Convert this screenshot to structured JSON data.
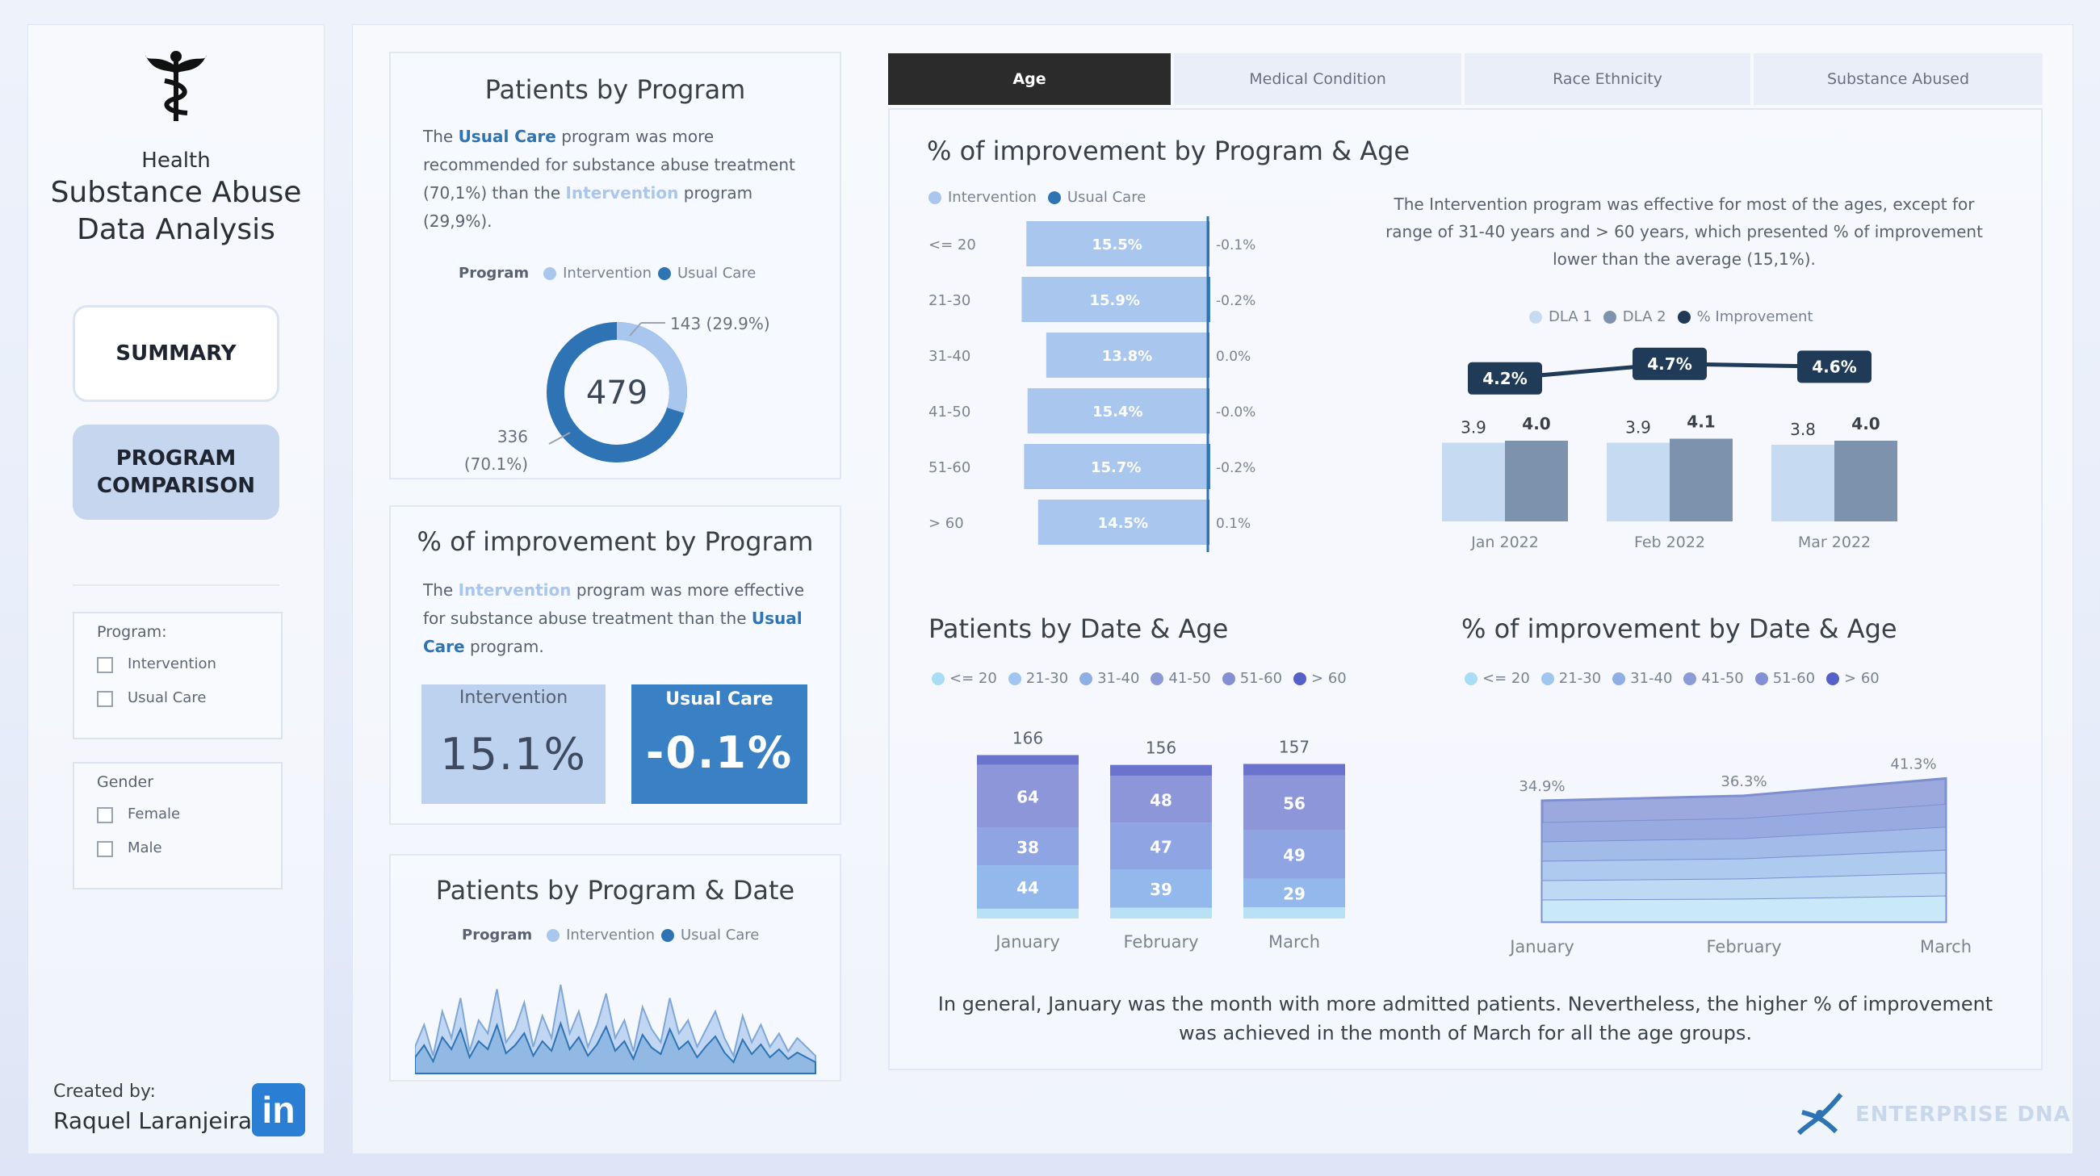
{
  "sidebar": {
    "brand_top": "Health",
    "brand_line1": "Substance Abuse",
    "brand_line2": "Data Analysis",
    "nav": [
      {
        "label": "SUMMARY"
      },
      {
        "label_line1": "PROGRAM",
        "label_line2": "COMPARISON"
      }
    ],
    "filters": [
      {
        "title": "Program:",
        "options": [
          "Intervention",
          "Usual Care"
        ]
      },
      {
        "title": "Gender",
        "options": [
          "Female",
          "Male"
        ]
      }
    ],
    "created_by_label": "Created by:",
    "author": "Raquel Laranjeira",
    "linkedin_glyph": "in"
  },
  "colors": {
    "intervention": "#a9c7ee",
    "usual_care": "#2e74b5",
    "active_tab": "#2b2b2b"
  },
  "patients_by_program": {
    "title": "Patients by Program",
    "desc": {
      "p1": "The ",
      "usual_care": "Usual Care",
      "p2": " program was more recommended for substance abuse treatment (70,1%) than the ",
      "intervention": "Intervention",
      "p3": " program (29,9%)."
    },
    "legend_title": "Program",
    "legend_intervention": "Intervention",
    "legend_usual": "Usual Care",
    "total": "479",
    "label_intervention": "143 (29.9%)",
    "label_usual_value": "336",
    "label_usual_pct": "(70.1%)"
  },
  "improvement_by_program": {
    "title": "% of improvement by Program",
    "desc": {
      "p1": "The ",
      "intervention": "Intervention",
      "p2": " program was more effective for substance abuse treatment than the ",
      "usual_care": "Usual Care",
      "p3": " program."
    },
    "kpi_intervention_label": "Intervention",
    "kpi_intervention_value": "15.1%",
    "kpi_usual_label": "Usual Care",
    "kpi_usual_value": "-0.1%"
  },
  "patients_by_program_date": {
    "title": "Patients by Program & Date",
    "legend_title": "Program",
    "legend_intervention": "Intervention",
    "legend_usual": "Usual Care"
  },
  "tabs": [
    {
      "label": "Age",
      "active": true
    },
    {
      "label": "Medical Condition",
      "active": false
    },
    {
      "label": "Race Ethnicity",
      "active": false
    },
    {
      "label": "Substance Abused",
      "active": false
    }
  ],
  "improvement_by_program_age": {
    "title": "% of improvement by Program & Age",
    "legend_intervention": "Intervention",
    "legend_usual": "Usual Care"
  },
  "dla_note": "The Intervention program was effective for most of the ages, except for range of 31-40 years and > 60 years, which presented % of improvement lower than the average (15,1%).",
  "dla_chart_legend": [
    "DLA 1",
    "DLA 2",
    "% Improvement"
  ],
  "patients_by_date_age": {
    "title": "Patients by Date & Age",
    "legend": [
      "<= 20",
      "21-30",
      "31-40",
      "41-50",
      "51-60",
      "> 60"
    ]
  },
  "improvement_by_date_age": {
    "title": "% of improvement by Date & Age",
    "legend": [
      "<= 20",
      "21-30",
      "31-40",
      "41-50",
      "51-60",
      "> 60"
    ]
  },
  "footer_note": {
    "line1": "In general, January was the month with more admitted patients. Nevertheless, the higher % of improvement",
    "line2": "was achieved in the month of March for all the age groups."
  },
  "enterprise_brand": "ENTERPRISE DNA",
  "chart_data": [
    {
      "type": "pie",
      "title": "Patients by Program",
      "categories": [
        "Intervention",
        "Usual Care"
      ],
      "values": [
        143,
        336
      ],
      "percent": [
        29.9,
        70.1
      ],
      "center_total": 479,
      "legend": "top"
    },
    {
      "type": "bar",
      "orientation": "horizontal",
      "title": "% of improvement by Program & Age",
      "categories": [
        "<= 20",
        "21-30",
        "31-40",
        "41-50",
        "51-60",
        "> 60"
      ],
      "series": [
        {
          "name": "Intervention",
          "values": [
            15.5,
            15.9,
            13.8,
            15.4,
            15.7,
            14.5
          ],
          "labels": [
            "15.5%",
            "15.9%",
            "13.8%",
            "15.4%",
            "15.7%",
            "14.5%"
          ]
        },
        {
          "name": "Usual Care",
          "values": [
            -0.1,
            -0.2,
            0.0,
            0.0,
            -0.2,
            0.1
          ],
          "labels": [
            "-0.1%",
            "-0.2%",
            "0.0%",
            "-0.0%",
            "-0.2%",
            "0.1%"
          ]
        }
      ],
      "legend": "top-left"
    },
    {
      "type": "bar",
      "title": "",
      "categories": [
        "Jan 2022",
        "Feb 2022",
        "Mar 2022"
      ],
      "series": [
        {
          "name": "DLA 1",
          "values": [
            3.9,
            3.9,
            3.8
          ]
        },
        {
          "name": "DLA 2",
          "values": [
            4.0,
            4.1,
            4.0
          ]
        },
        {
          "name": "% Improvement",
          "type": "line",
          "values": [
            4.2,
            4.7,
            4.6
          ],
          "labels": [
            "4.2%",
            "4.7%",
            "4.6%"
          ]
        }
      ],
      "legend": "top"
    },
    {
      "type": "bar",
      "stacked": true,
      "title": "Patients by Date & Age",
      "categories": [
        "January",
        "February",
        "March"
      ],
      "totals": [
        166,
        156,
        157
      ],
      "segment_labels": [
        {
          "category": "January",
          "labels": [
            44,
            38,
            64
          ]
        },
        {
          "category": "February",
          "labels": [
            39,
            47,
            48
          ]
        },
        {
          "category": "March",
          "labels": [
            29,
            49,
            56
          ]
        }
      ],
      "legend": "top"
    },
    {
      "type": "area",
      "stacked": true,
      "title": "% of improvement by Date & Age",
      "categories": [
        "January",
        "February",
        "March"
      ],
      "top_labels": [
        "34.9%",
        "36.3%",
        "41.3%"
      ],
      "totals": [
        34.9,
        36.3,
        41.3
      ],
      "legend": "top"
    }
  ]
}
